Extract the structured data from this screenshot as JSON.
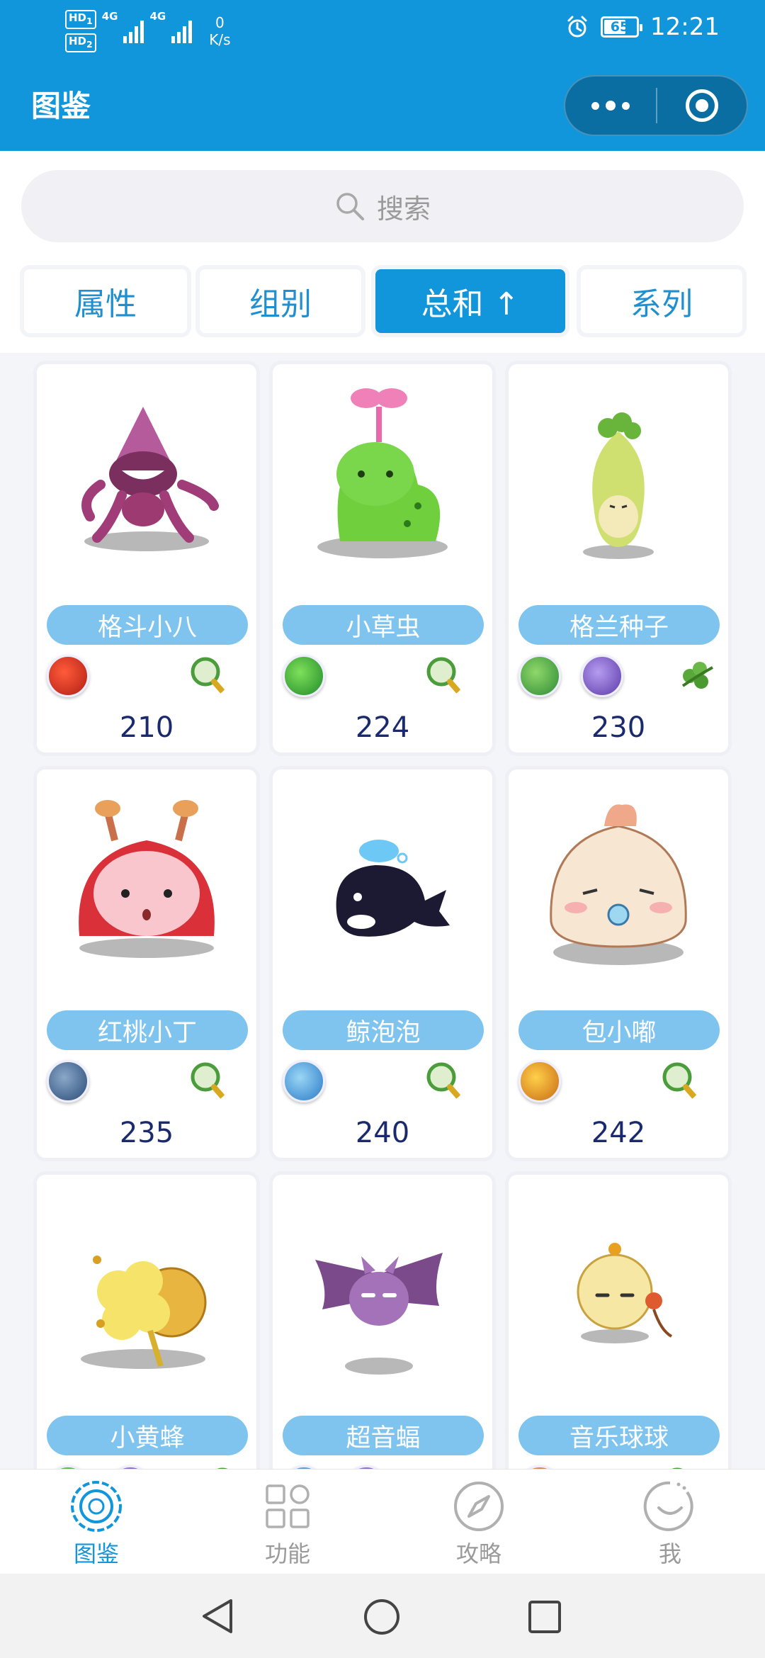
{
  "status_bar": {
    "hd1": "HD",
    "sub1": "1",
    "hd2": "HD",
    "sub2": "2",
    "net1": "4G",
    "net2": "4G",
    "speed_value": "0",
    "speed_unit": "K/s",
    "alarm_icon": "alarm-icon",
    "battery": "65",
    "time": "12:21"
  },
  "header": {
    "title": "图鉴",
    "more_icon": "more-dots-icon",
    "close_icon": "target-close-icon"
  },
  "search": {
    "placeholder": "搜索",
    "icon": "search-icon"
  },
  "filters": [
    {
      "label": "属性",
      "active": false
    },
    {
      "label": "组别",
      "active": false
    },
    {
      "label": "总和 ↑",
      "active": true
    },
    {
      "label": "系列",
      "active": false
    }
  ],
  "colors": {
    "primary": "#1296db",
    "pill": "#7fc4ee",
    "total_text": "#1a2a6c"
  },
  "pets": [
    {
      "name": "格斗小八",
      "total": "210",
      "tags": [
        "fire-attribute-icon",
        "magnifier-icon"
      ]
    },
    {
      "name": "小草虫",
      "total": "224",
      "tags": [
        "bug-attribute-icon",
        "magnifier-icon"
      ]
    },
    {
      "name": "格兰种子",
      "total": "230",
      "tags": [
        "grass-attribute-icon",
        "wind-attribute-icon",
        "vine-group-icon"
      ]
    },
    {
      "name": "红桃小丁",
      "total": "235",
      "tags": [
        "machine-attribute-icon",
        "magnifier-icon"
      ]
    },
    {
      "name": "鲸泡泡",
      "total": "240",
      "tags": [
        "water-attribute-icon",
        "magnifier-icon"
      ]
    },
    {
      "name": "包小嘟",
      "total": "242",
      "tags": [
        "star-attribute-icon",
        "magnifier-icon"
      ]
    },
    {
      "name": "小黄蜂",
      "total": "",
      "tags": [
        "grass-attribute-icon",
        "purple-attribute-icon",
        "magnifier-icon"
      ]
    },
    {
      "name": "超音蝠",
      "total": "",
      "tags": [
        "blue-attribute-icon",
        "purple-attribute-icon",
        "gold-group-icon"
      ]
    },
    {
      "name": "音乐球球",
      "total": "",
      "tags": [
        "orange-attribute-icon",
        "magnifier-icon"
      ]
    }
  ],
  "tabbar": [
    {
      "label": "图鉴",
      "icon": "flower-badge-icon",
      "active": true
    },
    {
      "label": "功能",
      "icon": "grid-apps-icon",
      "active": false
    },
    {
      "label": "攻略",
      "icon": "compass-icon",
      "active": false
    },
    {
      "label": "我",
      "icon": "smile-profile-icon",
      "active": false
    }
  ],
  "system_nav": {
    "back": "back-triangle-icon",
    "home": "home-circle-icon",
    "recents": "recents-square-icon"
  }
}
